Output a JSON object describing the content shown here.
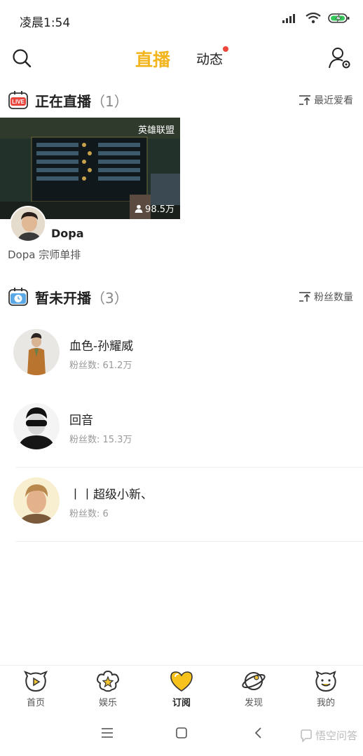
{
  "status": {
    "time": "凌晨1:54"
  },
  "header": {
    "tab_live": "直播",
    "tab_feed": "动态"
  },
  "live_section": {
    "title": "正在直播",
    "count": "（1）",
    "sort_label": "最近爱看",
    "stream": {
      "game_tag": "英雄联盟",
      "viewers": "98.5万",
      "streamer": "Dopa",
      "description": "Dopa 宗师单排"
    }
  },
  "offline_section": {
    "title": "暂未开播",
    "count": "（3）",
    "sort_label": "粉丝数量",
    "anchors": [
      {
        "name": "血色-孙耀威",
        "fans": "粉丝数: 61.2万"
      },
      {
        "name": "回音",
        "fans": "粉丝数: 15.3万"
      },
      {
        "name": "丨丨超级小新、",
        "fans": "粉丝数: 6"
      }
    ]
  },
  "tabbar": {
    "items": [
      {
        "label": "首页"
      },
      {
        "label": "娱乐"
      },
      {
        "label": "订阅"
      },
      {
        "label": "发现"
      },
      {
        "label": "我的"
      }
    ],
    "active": "订阅"
  },
  "watermark": "悟空问答",
  "colors": {
    "accent": "#f2b51d",
    "live_badge": "#e8453c",
    "badge_dot": "#f0453a"
  }
}
